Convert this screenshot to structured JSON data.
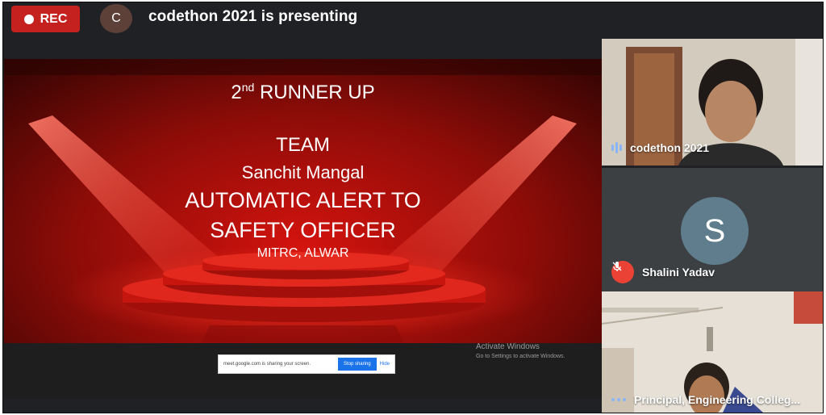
{
  "topbar": {
    "rec_label": "REC",
    "presenter_initial": "C",
    "presenting_text": "codethon 2021 is presenting"
  },
  "slide": {
    "runner_prefix": "2",
    "runner_sup": "nd",
    "runner_suffix": " RUNNER UP",
    "team_label": "TEAM",
    "team_name": "Sanchit Mangal",
    "project_line1": "AUTOMATIC ALERT TO",
    "project_line2": "SAFETY OFFICER",
    "institution": "MITRC, ALWAR"
  },
  "share_bar": {
    "message": "meet.google.com is sharing your screen.",
    "stop_label": "Stop sharing",
    "hide_label": "Hide"
  },
  "watermark": {
    "title": "Activate Windows",
    "subtitle": "Go to Settings to activate Windows."
  },
  "participants": [
    {
      "name": "codethon 2021",
      "status": "speaking"
    },
    {
      "name": "Shalini Yadav",
      "initial": "S",
      "status": "muted"
    },
    {
      "name": "Principal, Engineering Colleg...",
      "status": "idle"
    }
  ],
  "colors": {
    "rec": "#c5221f",
    "stage_red": "#b3120f",
    "accent_blue": "#8ab4f8",
    "mute_red": "#ea4335"
  }
}
